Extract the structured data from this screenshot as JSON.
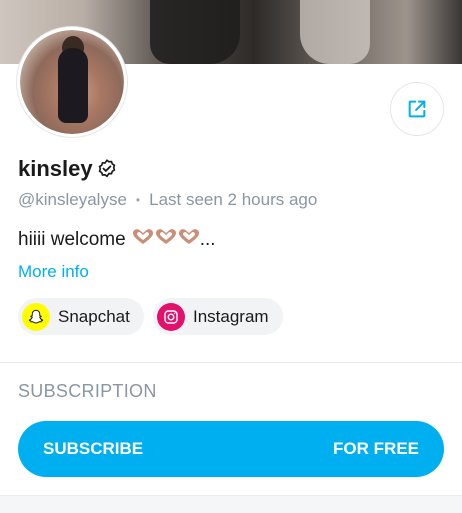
{
  "profile": {
    "name": "kinsley",
    "handle": "@kinsleyalyse",
    "separator": "•",
    "last_seen": "Last seen 2 hours ago",
    "bio_text": "hiiii welcome",
    "bio_suffix": "...",
    "more_info": "More info"
  },
  "social": [
    {
      "label": "Snapchat",
      "icon": "snapchat-icon",
      "color": "#fffc00"
    },
    {
      "label": "Instagram",
      "icon": "instagram-icon",
      "color": "#e3106e"
    }
  ],
  "subscription": {
    "title": "SUBSCRIPTION",
    "button_label": "SUBSCRIBE",
    "price_label": "FOR FREE"
  },
  "colors": {
    "accent": "#00aff0",
    "muted_text": "#8a96a3",
    "heart": "#c98f78"
  }
}
